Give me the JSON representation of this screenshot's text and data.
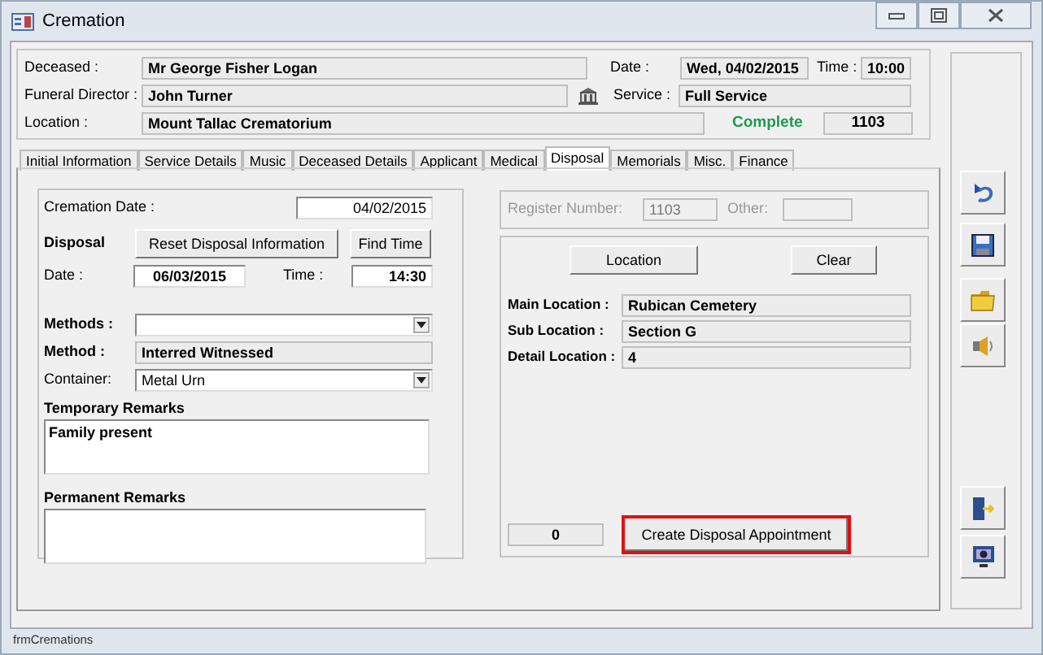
{
  "window": {
    "title": "Cremation"
  },
  "header": {
    "deceased": {
      "label": "Deceased :",
      "value": "Mr George Fisher Logan"
    },
    "funeral_director": {
      "label": "Funeral Director :",
      "value": "John Turner"
    },
    "location": {
      "label": "Location :",
      "value": "Mount Tallac Crematorium"
    },
    "date": {
      "label": "Date :",
      "value": "Wed, 04/02/2015"
    },
    "time": {
      "label": "Time :",
      "value": "10:00"
    },
    "service": {
      "label": "Service :",
      "value": "Full Service"
    },
    "status": "Complete",
    "number": "1103"
  },
  "tabs": [
    {
      "label": "Initial Information",
      "selected": false
    },
    {
      "label": "Service Details",
      "selected": false
    },
    {
      "label": "Music",
      "selected": false
    },
    {
      "label": "Deceased Details",
      "selected": false
    },
    {
      "label": "Applicant",
      "selected": false
    },
    {
      "label": "Medical",
      "selected": false
    },
    {
      "label": "Disposal",
      "selected": true
    },
    {
      "label": "Memorials",
      "selected": false
    },
    {
      "label": "Misc.",
      "selected": false
    },
    {
      "label": "Finance",
      "selected": false
    }
  ],
  "disposal": {
    "cremation_date": {
      "label": "Cremation Date :",
      "value": "04/02/2015"
    },
    "heading": "Disposal",
    "reset_button": "Reset Disposal Information",
    "find_time_button": "Find Time",
    "date": {
      "label": "Date :",
      "value": "06/03/2015"
    },
    "time": {
      "label": "Time :",
      "value": "14:30"
    },
    "methods": {
      "label": "Methods :"
    },
    "method": {
      "label": "Method :",
      "value": "Interred Witnessed"
    },
    "container": {
      "label": "Container:",
      "value": "Metal Urn"
    },
    "temporary_remarks": {
      "label": "Temporary Remarks",
      "value": "Family present"
    },
    "permanent_remarks": {
      "label": "Permanent Remarks"
    }
  },
  "register": {
    "disabled": true,
    "register_label": "Register Number:",
    "register_value": "1103",
    "other_label": "Other:"
  },
  "location_panel": {
    "location_button": "Location",
    "clear_button": "Clear",
    "fields": [
      {
        "label": "Main Location :",
        "value": "Rubican Cemetery"
      },
      {
        "label": "Sub Location :",
        "value": "Section G"
      },
      {
        "label": "Detail Location :",
        "value": "4"
      }
    ],
    "count": "0",
    "create_button": {
      "label": "Create Disposal Appointment",
      "highlighted": true
    }
  },
  "status_bar": "frmCremations"
}
